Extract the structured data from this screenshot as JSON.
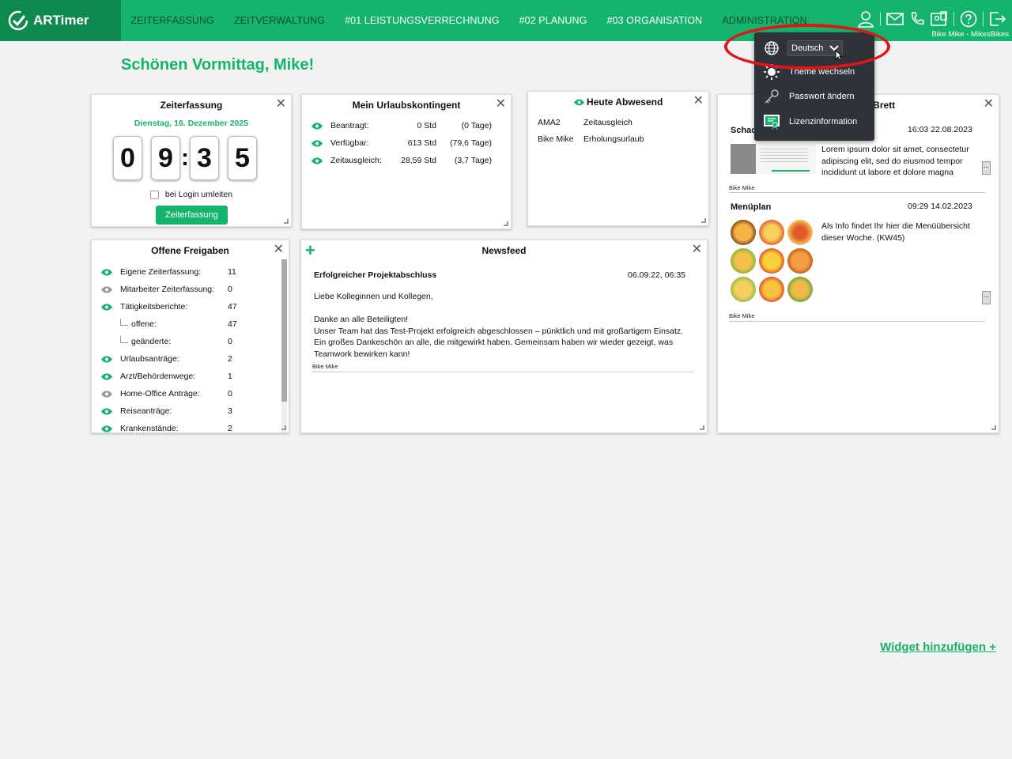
{
  "colors": {
    "brand_green": "#14b46c",
    "dark_green": "#0e8a4e",
    "annotation_red": "#e2141a",
    "dropdown_bg": "#2e3239"
  },
  "app": {
    "name": "ARTimer"
  },
  "nav": {
    "items": [
      "ZEITERFASSUNG",
      "ZEITVERWALTUNG",
      "#01 LEISTUNGSVERRECHNUNG",
      "#02 PLANUNG",
      "#03 ORGANISATION",
      "ADMINISTRATION"
    ]
  },
  "header": {
    "icons": [
      "user-icon",
      "mail-icon",
      "phone-icon",
      "id-card-icon",
      "help-icon",
      "logout-icon"
    ],
    "user_line": "Bike Mike - MikesBikes"
  },
  "greeting": "Schönen Vormittag, Mike!",
  "zeiterfassung": {
    "title": "Zeiterfassung",
    "date": "Dienstag, 16. Dezember 2025",
    "digits": [
      "0",
      "9",
      "3",
      "5"
    ],
    "colon": ":",
    "checkbox_label": "bei Login umleiten",
    "button_label": "Zeiterfassung"
  },
  "urlaub": {
    "title": "Mein Urlaubskontingent",
    "rows": [
      {
        "label": "Beantragt:",
        "hours": "0 Std",
        "days": "(0 Tage)"
      },
      {
        "label": "Verfügbar:",
        "hours": "613 Std",
        "days": "(79,6 Tage)"
      },
      {
        "label": "Zeitausgleich:",
        "hours": "28,59 Std",
        "days": "(3,7 Tage)"
      }
    ]
  },
  "abwesend": {
    "title": "Heute Abwesend",
    "rows": [
      {
        "name": "AMA2",
        "reason": "Zeitausgleich"
      },
      {
        "name": "Bike Mike",
        "reason": "Erholungsurlaub"
      }
    ]
  },
  "brett": {
    "title": "Schwarzes Brett",
    "posts": [
      {
        "title": "Schach",
        "date": "16:03 22.08.2023",
        "text": "Lorem ipsum dolor sit amet, consectetur adipiscing elit, sed do eiusmod tempor incididunt ut labore et dolore magna",
        "author": "Bike Mike",
        "more": "..."
      },
      {
        "title": "Menüplan",
        "date": "09:29 14.02.2023",
        "text": "Als Info findet Ihr hier die Menüübersicht dieser Woche. (KW45)",
        "author": "Bike Mike",
        "more": "..."
      }
    ]
  },
  "freigaben": {
    "title": "Offene Freigaben",
    "rows": [
      {
        "label": "Eigene Zeiterfassung:",
        "value": "11"
      },
      {
        "label": "Mitarbeiter Zeiterfassung:",
        "value": "0"
      },
      {
        "label": "Tätigkeitsberichte:",
        "value": "47"
      },
      {
        "label": "offene:",
        "value": "47"
      },
      {
        "label": "geänderte:",
        "value": "0"
      },
      {
        "label": "Urlaubsanträge:",
        "value": "2"
      },
      {
        "label": "Arzt/Behördenwege:",
        "value": "1"
      },
      {
        "label": "Home-Office Anträge:",
        "value": "0"
      },
      {
        "label": "Reiseanträge:",
        "value": "3"
      },
      {
        "label": "Krankenstände:",
        "value": "2"
      }
    ]
  },
  "newsfeed": {
    "title": "Newsfeed",
    "add_symbol": "+",
    "post_title": "Erfolgreicher Projektabschluss",
    "post_date": "06.09.22, 06:35",
    "greeting": "Liebe Kolleginnen und Kollegen,",
    "line2": "Danke an alle Beteiligten!",
    "body": "Unser Team hat das Test-Projekt erfolgreich abgeschlossen – pünktlich und mit großartigem Einsatz. Ein großes Dankeschön an alle, die mitgewirkt haben. Gemeinsam haben wir wieder gezeigt, was Teamwork bewirken kann!",
    "author": "Bike Mike"
  },
  "widget_add": "Widget hinzufügen +",
  "dropdown": {
    "language": "Deutsch",
    "items": [
      "Theme wechseln",
      "Passwort ändern",
      "Lizenzinformation"
    ]
  },
  "close_symbol": "✕"
}
